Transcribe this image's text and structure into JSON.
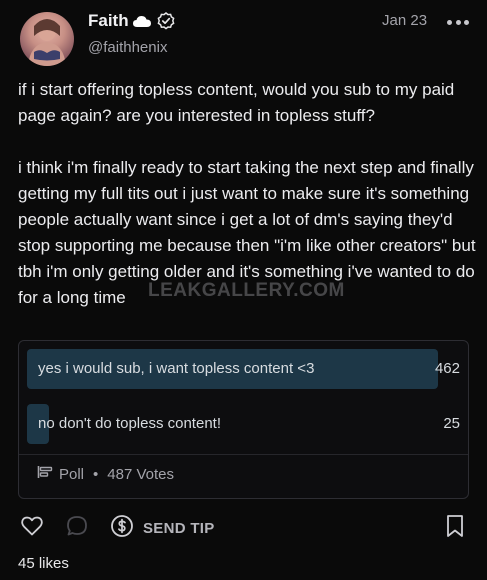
{
  "author": {
    "name": "Faith",
    "handle": "@faithhenix",
    "avatar_icon": "avatar-photo",
    "badges": [
      "cloud-icon",
      "verified-check-icon"
    ]
  },
  "post": {
    "date": "Jan 23",
    "paragraphs": [
      "if i start offering topless content, would you sub to my paid page again? are you interested in topless stuff?",
      "i think i'm finally ready to start taking the next step and finally getting my full tits out i just want to make sure it's something people actually want since i get a lot of dm's saying they'd stop supporting me because then \"i'm like other creators\" but tbh i'm only getting older and it's something i've wanted to do for a long time"
    ],
    "watermark": "LEAKGALLERY.COM"
  },
  "poll": {
    "options": [
      {
        "label": "yes i would sub, i want topless content <3",
        "votes": "462",
        "fill_percent": 94.9
      },
      {
        "label": "no don't do topless content!",
        "votes": "25",
        "fill_percent": 5.1
      }
    ],
    "footer_label": "Poll",
    "footer_separator": "•",
    "total_votes": "487 Votes"
  },
  "actions": {
    "tip_label": "SEND TIP",
    "likes": "45 likes"
  },
  "colors": {
    "background": "#0a0a0a",
    "poll_fill": "#1d3747",
    "muted_text": "#a3a3aa"
  }
}
